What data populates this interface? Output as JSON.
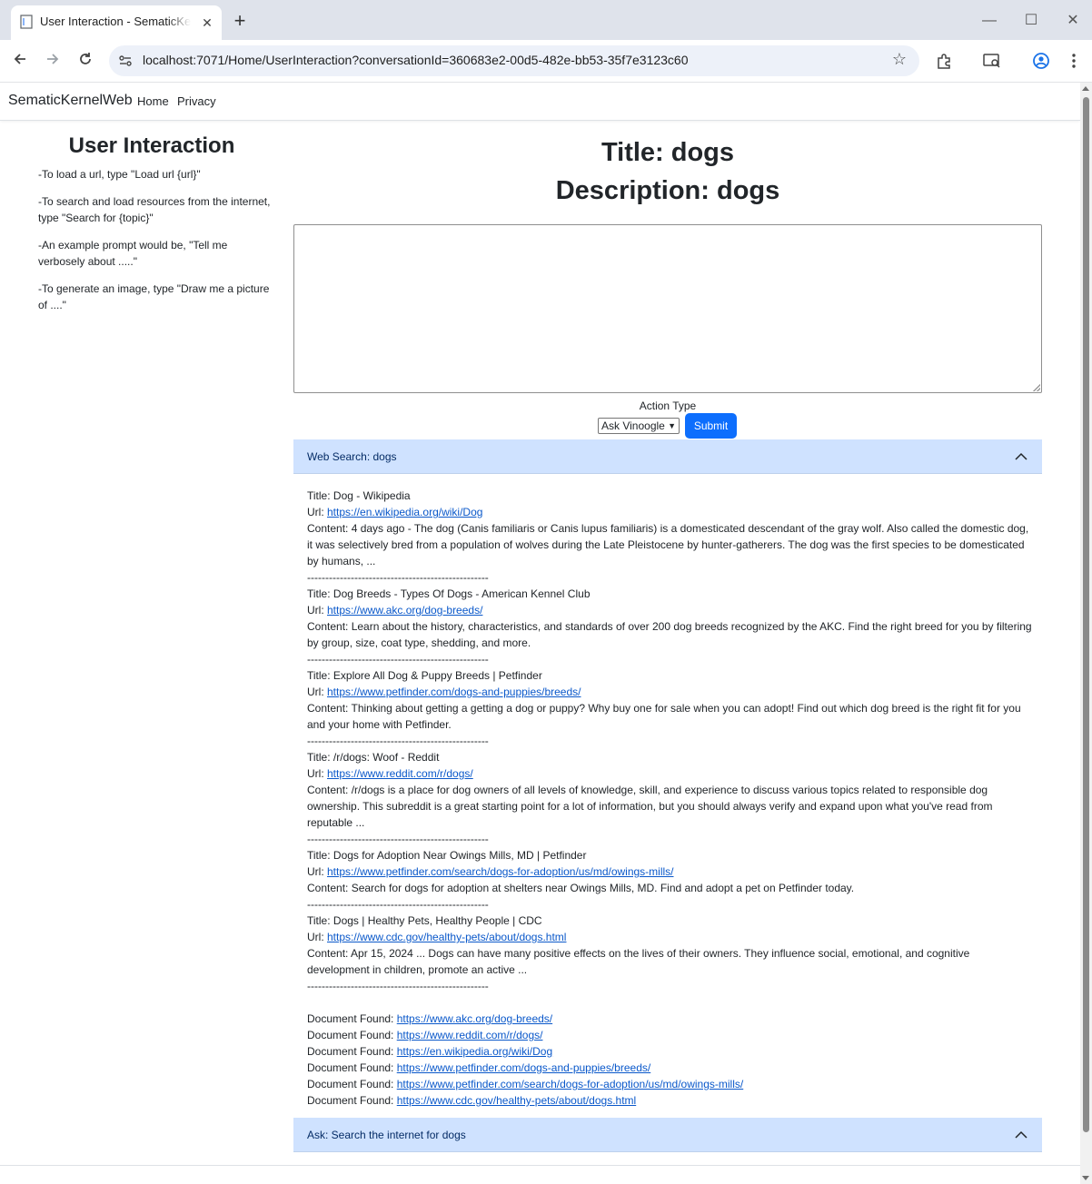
{
  "browser": {
    "tab_title": "User Interaction - SematicKernelWeb",
    "url": "localhost:7071/Home/UserInteraction?conversationId=360683e2-00d5-482e-bb53-35f7e3123c60"
  },
  "app": {
    "brand": "SematicKernelWeb",
    "nav": [
      "Home",
      "Privacy"
    ]
  },
  "sidebar": {
    "title": "User Interaction",
    "tips": [
      "-To load a url, type \"Load url {url}\"",
      "-To search and load resources from the internet, type \"Search for {topic}\"",
      "-An example prompt would be, \"Tell me verbosely about .....\"",
      "-To generate an image, type \"Draw me a picture of ....\""
    ]
  },
  "main": {
    "title": "Title: dogs",
    "description": "Description: dogs",
    "prompt_value": "",
    "action_label": "Action Type",
    "action_selected": "Ask Vinoogle",
    "submit_label": "Submit"
  },
  "web_search": {
    "header": "Web Search: dogs",
    "title_prefix": "Title: ",
    "url_prefix": "Url: ",
    "content_prefix": "Content: ",
    "separator": "--------------------------------------------------",
    "results": [
      {
        "title": "Dog - Wikipedia",
        "url": "https://en.wikipedia.org/wiki/Dog",
        "content": "4 days ago - The dog (Canis familiaris or Canis lupus familiaris) is a domesticated descendant of the gray wolf. Also called the domestic dog, it was selectively bred from a population of wolves during the Late Pleistocene by hunter-gatherers. The dog was the first species to be domesticated by humans, ..."
      },
      {
        "title": "Dog Breeds - Types Of Dogs - American Kennel Club",
        "url": "https://www.akc.org/dog-breeds/",
        "content": "Learn about the history, characteristics, and standards of over 200 dog breeds recognized by the AKC. Find the right breed for you by filtering by group, size, coat type, shedding, and more."
      },
      {
        "title": "Explore All Dog & Puppy Breeds | Petfinder",
        "url": "https://www.petfinder.com/dogs-and-puppies/breeds/",
        "content": "Thinking about getting a getting a dog or puppy? Why buy one for sale when you can adopt! Find out which dog breed is the right fit for you and your home with Petfinder."
      },
      {
        "title": "/r/dogs: Woof - Reddit",
        "url": "https://www.reddit.com/r/dogs/",
        "content": "/r/dogs is a place for dog owners of all levels of knowledge, skill, and experience to discuss various topics related to responsible dog ownership. This subreddit is a great starting point for a lot of information, but you should always verify and expand upon what you've read from reputable ..."
      },
      {
        "title": "Dogs for Adoption Near Owings Mills, MD | Petfinder",
        "url": "https://www.petfinder.com/search/dogs-for-adoption/us/md/owings-mills/",
        "content": "Search for dogs for adoption at shelters near Owings Mills, MD. Find and adopt a pet on Petfinder today."
      },
      {
        "title": "Dogs | Healthy Pets, Healthy People | CDC",
        "url": "https://www.cdc.gov/healthy-pets/about/dogs.html",
        "content": "Apr 15, 2024 ... Dogs can have many positive effects on the lives of their owners. They influence social, emotional, and cognitive development in children, promote an active ..."
      }
    ],
    "documents_prefix": "Document Found: ",
    "documents": [
      "https://www.akc.org/dog-breeds/",
      "https://www.reddit.com/r/dogs/",
      "https://en.wikipedia.org/wiki/Dog",
      "https://www.petfinder.com/dogs-and-puppies/breeds/",
      "https://www.petfinder.com/search/dogs-for-adoption/us/md/owings-mills/",
      "https://www.cdc.gov/healthy-pets/about/dogs.html"
    ]
  },
  "ask": {
    "header": "Ask: Search the internet for dogs"
  },
  "colors": {
    "accordion_bg": "#cfe2ff",
    "primary": "#0d6efd",
    "link": "#0a58ca"
  },
  "icons": [
    "page-icon",
    "close-icon",
    "plus-icon",
    "minimize-icon",
    "maximize-icon",
    "back-icon",
    "forward-icon",
    "reload-icon",
    "site-info-icon",
    "star-icon",
    "extensions-icon",
    "cast-search-icon",
    "profile-icon",
    "menu-icon",
    "chevron-up-icon"
  ]
}
